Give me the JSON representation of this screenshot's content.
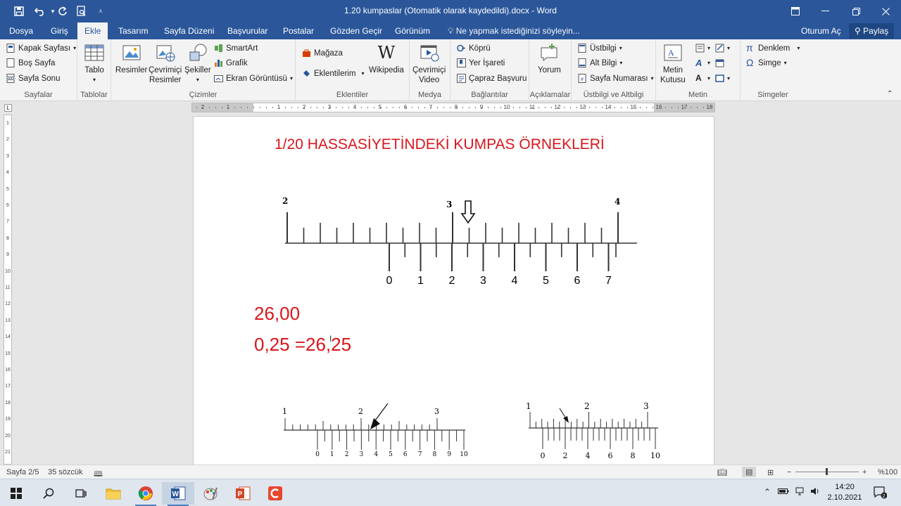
{
  "window": {
    "title": "1.20 kumpaslar (Otomatik olarak kaydedildi).docx - Word",
    "quick_access": [
      "save-icon",
      "undo-icon",
      "redo-icon",
      "print-preview-icon",
      "customize-icon"
    ]
  },
  "tabs": [
    "Dosya",
    "Giriş",
    "Ekle",
    "Tasarım",
    "Sayfa Düzeni",
    "Başvurular",
    "Postalar",
    "Gözden Geçir",
    "Görünüm"
  ],
  "active_tab": "Ekle",
  "tell_me": "Ne yapmak istediğinizi söyleyin...",
  "account": {
    "sign_in": "Oturum Aç",
    "share": "Paylaş"
  },
  "ribbon": {
    "sayfalar": {
      "label": "Sayfalar",
      "items": [
        "Kapak Sayfası",
        "Boş Sayfa",
        "Sayfa Sonu"
      ]
    },
    "tablolar": {
      "label": "Tablolar",
      "items": [
        "Tablo"
      ]
    },
    "cizimler": {
      "label": "Çizimler",
      "big": [
        "Resimler",
        "Çevrimiçi",
        "Resimler",
        "Şekiller"
      ],
      "small": [
        "SmartArt",
        "Grafik",
        "Ekran Görüntüsü"
      ]
    },
    "eklentiler": {
      "label": "Eklentiler",
      "items": [
        "Mağaza",
        "Eklentilerim",
        "Wikipedia"
      ]
    },
    "medya": {
      "label": "Medya",
      "items": [
        "Çevrimiçi",
        "Video"
      ]
    },
    "baglantilar": {
      "label": "Bağlantılar",
      "items": [
        "Köprü",
        "Yer İşareti",
        "Çapraz Başvuru"
      ]
    },
    "aciklamalar": {
      "label": "Açıklamalar",
      "items": [
        "Yorum"
      ]
    },
    "ustbilgi": {
      "label": "Üstbilgi ve Altbilgi",
      "items": [
        "Üstbilgi",
        "Alt Bilgi",
        "Sayfa Numarası"
      ]
    },
    "metin": {
      "label": "Metin",
      "items": [
        "Metin",
        "Kutusu"
      ]
    },
    "simgeler": {
      "label": "Simgeler",
      "items": [
        "Denklem",
        "Simge"
      ]
    }
  },
  "ruler": {
    "h_labels": [
      "2",
      "1",
      "1",
      "2",
      "3",
      "4",
      "5",
      "6",
      "7",
      "8",
      "9",
      "10",
      "11",
      "12",
      "13",
      "14",
      "15",
      "16",
      "17",
      "18"
    ],
    "v_labels": [
      "1",
      "2",
      "3",
      "4",
      "5",
      "6",
      "7",
      "8",
      "9",
      "10",
      "11",
      "12",
      "13",
      "14",
      "15",
      "16",
      "17",
      "18",
      "19",
      "20",
      "21"
    ]
  },
  "document": {
    "heading": "1/20 HASSASİYETİNDEKİ KUMPAS ÖRNEKLERİ",
    "value1": "26,00",
    "value2": "0,25 =26,25",
    "text_color": "#d9161c",
    "caliper_main": {
      "main_labels": [
        "2",
        "3",
        "4"
      ],
      "vernier_labels": [
        "0",
        "1",
        "2",
        "3",
        "4",
        "5",
        "6",
        "7"
      ]
    },
    "caliper_small_left": {
      "main_labels": [
        "1",
        "2",
        "3"
      ],
      "vernier_labels": [
        "0",
        "1",
        "2",
        "3",
        "4",
        "5",
        "6",
        "7",
        "8",
        "9",
        "10"
      ]
    },
    "caliper_small_right": {
      "main_labels": [
        "1",
        "2",
        "3"
      ],
      "vernier_labels": [
        "0",
        "2",
        "4",
        "6",
        "8",
        "10"
      ]
    }
  },
  "status": {
    "page": "Sayfa 2/5",
    "words": "35 sözcük",
    "zoom": "%100"
  },
  "taskbar": {
    "apps": [
      "Windows",
      "Ara",
      "Görev Görünümü",
      "Dosya Gezgini",
      "Chrome",
      "Word",
      "Paint",
      "PowerPoint",
      "Camtasia"
    ],
    "time": "14:20",
    "date": "2.10.2021",
    "notifications": "2"
  },
  "colors": {
    "accent": "#2b579a",
    "ribbon_bg": "#f3f3f3",
    "document_red": "#d9161c"
  }
}
